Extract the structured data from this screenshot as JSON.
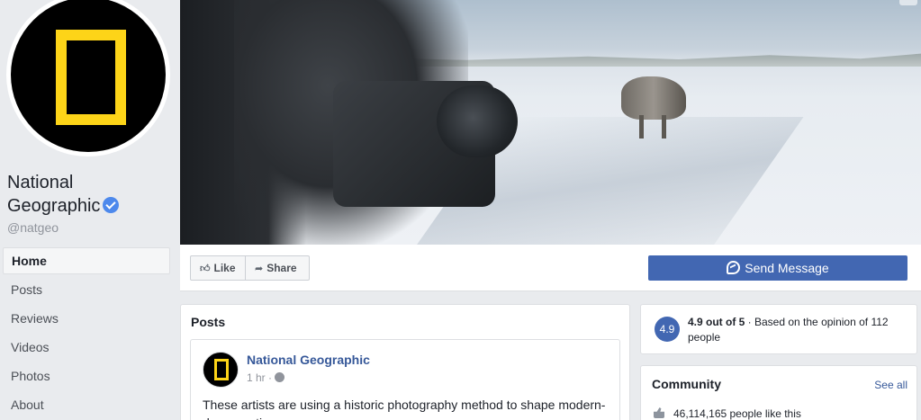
{
  "profile": {
    "name_line1": "National",
    "name_line2": "Geographic",
    "handle": "@natgeo"
  },
  "nav": {
    "items": [
      {
        "label": "Home",
        "active": true
      },
      {
        "label": "Posts"
      },
      {
        "label": "Reviews"
      },
      {
        "label": "Videos"
      },
      {
        "label": "Photos"
      },
      {
        "label": "About"
      }
    ]
  },
  "actions": {
    "like_label": "Like",
    "share_label": "Share",
    "send_message_label": "Send Message"
  },
  "posts": {
    "title": "Posts",
    "first_post": {
      "author": "National Geographic",
      "time": "1 hr ·",
      "text": "These artists are using a historic photography method to shape modern-day narratives"
    }
  },
  "rating": {
    "score": "4.9",
    "score_text": "4.9 out of 5",
    "detail": " · Based on the opinion of 112 people"
  },
  "community": {
    "title": "Community",
    "see_all": "See all",
    "likes_text": "46,114,165 people like this"
  },
  "colors": {
    "brand_blue": "#4267b2",
    "link_blue": "#365899",
    "natgeo_yellow": "#fdd418",
    "background": "#e9ebee"
  }
}
